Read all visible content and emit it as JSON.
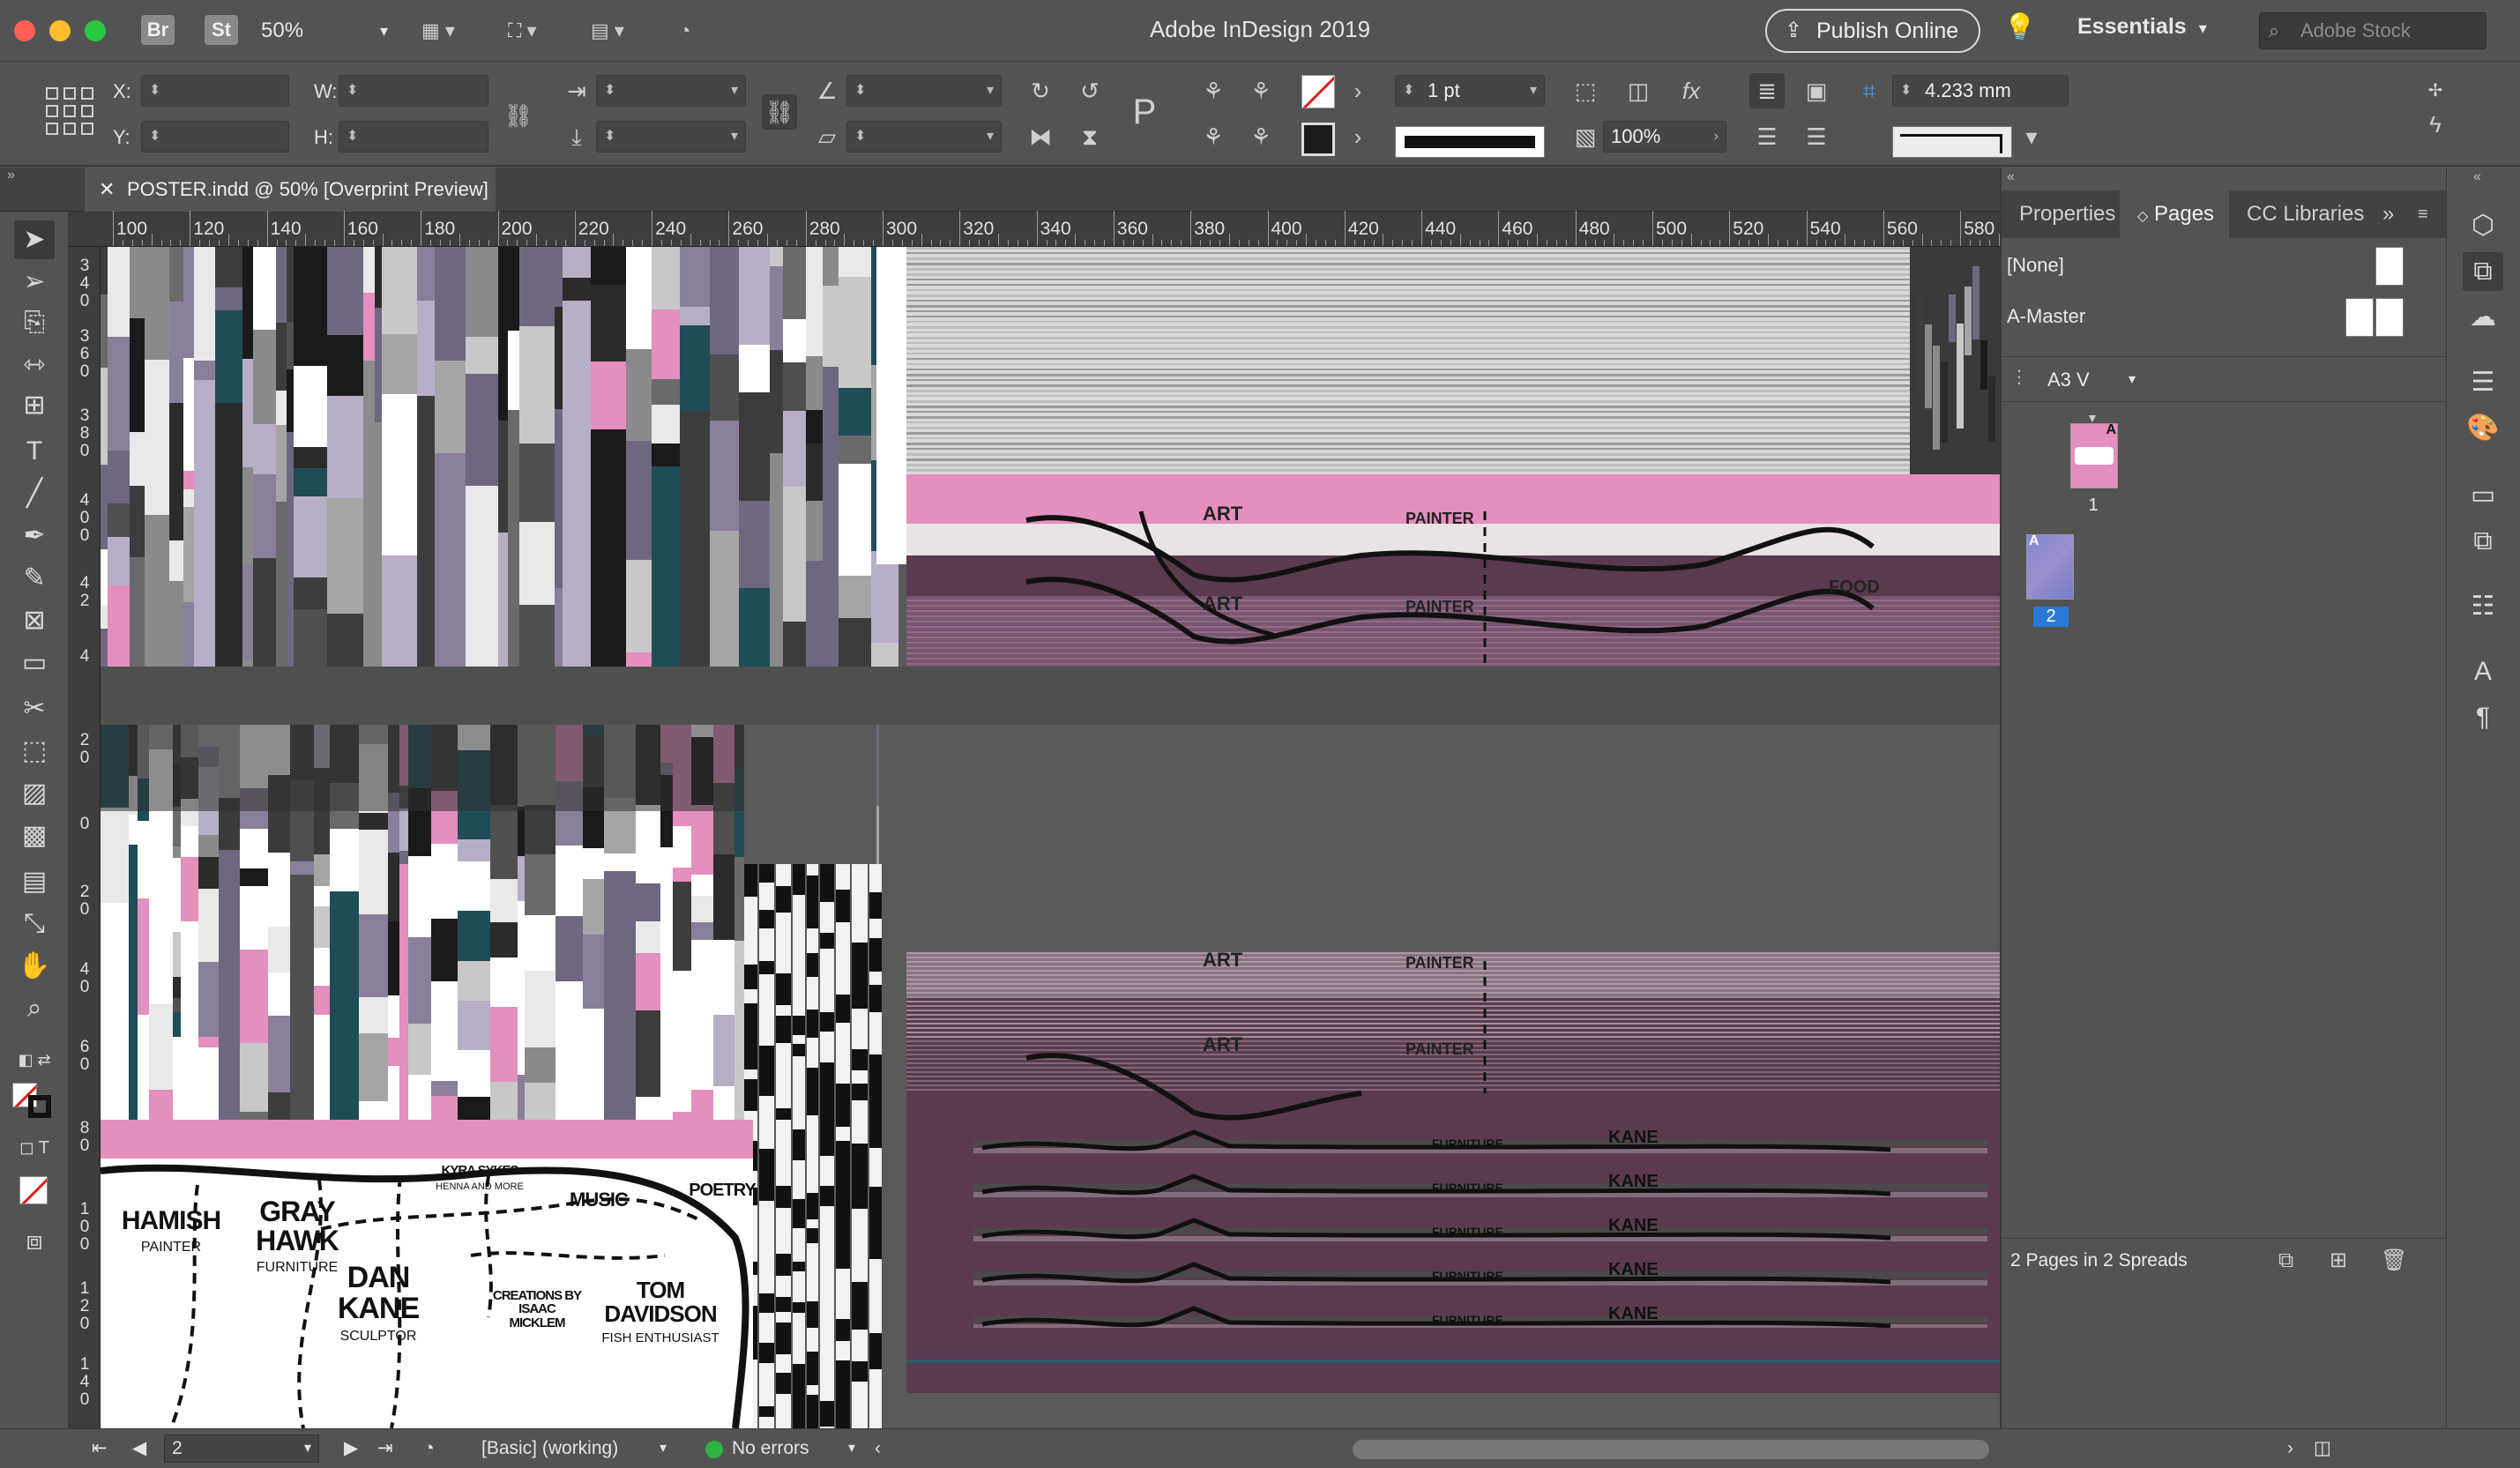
{
  "titlebar": {
    "bridge_label": "Br",
    "stock_label": "St",
    "zoom": "50%",
    "app_title": "Adobe InDesign 2019",
    "publish_label": "Publish Online",
    "workspace": "Essentials",
    "stock_placeholder": "Adobe Stock"
  },
  "control": {
    "x_label": "X:",
    "y_label": "Y:",
    "w_label": "W:",
    "h_label": "H:",
    "stroke_weight": "1 pt",
    "scale_percent": "100%",
    "frame_dimension": "4.233 mm"
  },
  "document": {
    "tab_title": "POSTER.indd @ 50% [Overprint Preview]"
  },
  "ruler": {
    "h_labels": [
      "100",
      "120",
      "140",
      "160",
      "180",
      "200",
      "220",
      "240",
      "260",
      "280",
      "300",
      "320",
      "340",
      "360",
      "380",
      "400",
      "420",
      "440",
      "460",
      "480",
      "500",
      "520",
      "540",
      "560",
      "580"
    ],
    "v_labels": [
      {
        "text": "3\n4\n0"
      },
      {
        "text": "3\n6\n0"
      },
      {
        "text": "3\n8\n0"
      },
      {
        "text": "4\n0\n0"
      },
      {
        "text": "4\n2"
      },
      {
        "text": "4"
      },
      {
        "text": "2\n0"
      },
      {
        "text": "0"
      },
      {
        "text": "2\n0"
      },
      {
        "text": "4\n0"
      },
      {
        "text": "6\n0"
      },
      {
        "text": "8\n0"
      },
      {
        "text": "1\n0\n0"
      },
      {
        "text": "1\n2\n0"
      },
      {
        "text": "1\n4\n0"
      }
    ]
  },
  "artwork": {
    "map_names": [
      {
        "title": "HAMISH",
        "sub": "PAINTER"
      },
      {
        "title": "GRAY\nHAWK",
        "sub": "FURNITURE"
      },
      {
        "title": "DAN\nKANE",
        "sub": "SCULPTOR"
      },
      {
        "title": "TOM\nDAVIDSON",
        "sub": "FISH ENTHUSIAST"
      },
      {
        "title": "KYRA SYKES",
        "sub": "HENNA AND MORE"
      },
      {
        "title": "MUSIC",
        "sub": ""
      },
      {
        "title": "POETRY",
        "sub": ""
      },
      {
        "title": "CREATIONS BY\nISAAC\nMICKLEM",
        "sub": ""
      }
    ],
    "ghost_labels": [
      "ART",
      "PAINTER",
      "FOOD",
      "FURNITURE",
      "KANE"
    ]
  },
  "pages_panel": {
    "tabs": [
      "Properties",
      "Pages",
      "CC Libraries"
    ],
    "masters": [
      "[None]",
      "A-Master"
    ],
    "page_size": "A3 V",
    "pages": [
      {
        "num": "1",
        "master": "A"
      },
      {
        "num": "2",
        "master": "A"
      }
    ],
    "footer": "2 Pages in 2 Spreads"
  },
  "status": {
    "page": "2",
    "preflight_profile": "[Basic] (working)",
    "preflight_status": "No errors"
  },
  "colors": {
    "pink": "#e48fbd",
    "plum": "#5b3a4f",
    "teal": "#1f4d57",
    "accent_blue": "#2a79d6",
    "ok_green": "#2db33f"
  }
}
